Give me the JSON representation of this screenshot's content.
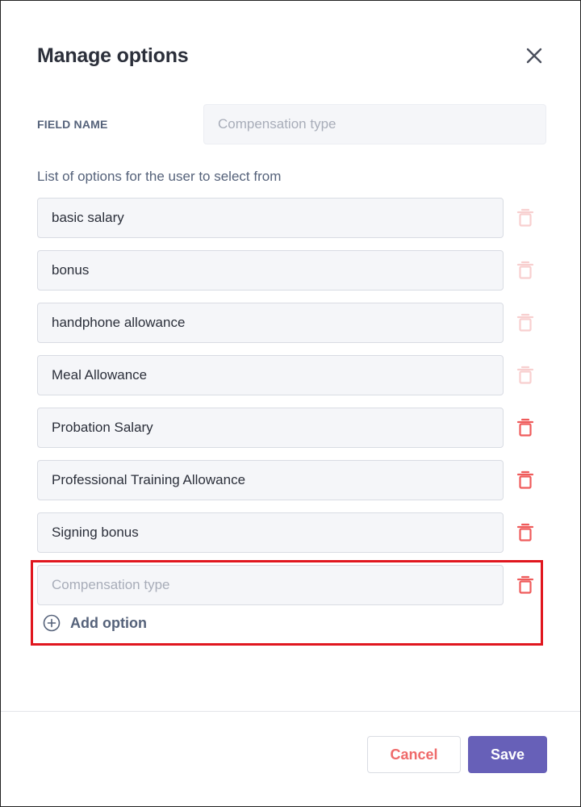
{
  "dialog": {
    "title": "Manage options",
    "close_icon": "close-icon"
  },
  "field": {
    "label": "FIELD NAME",
    "value": "",
    "placeholder": "Compensation type"
  },
  "options": {
    "label": "List of options for the user to select from",
    "items": [
      {
        "value": "basic salary",
        "delete_enabled": false
      },
      {
        "value": "bonus",
        "delete_enabled": false
      },
      {
        "value": "handphone allowance",
        "delete_enabled": false
      },
      {
        "value": "Meal Allowance",
        "delete_enabled": false
      },
      {
        "value": "Probation Salary",
        "delete_enabled": true
      },
      {
        "value": "Professional Training Allowance",
        "delete_enabled": true
      },
      {
        "value": "Signing bonus",
        "delete_enabled": true
      }
    ],
    "new_item": {
      "value": "",
      "placeholder": "Compensation type",
      "delete_enabled": true
    },
    "add_label": "Add option",
    "add_icon": "plus-circle-icon"
  },
  "footer": {
    "cancel_label": "Cancel",
    "save_label": "Save"
  },
  "colors": {
    "delete_enabled": "#ef5b5b",
    "delete_disabled": "#f8cfcf",
    "primary": "#6760b8",
    "highlight": "#e0161e"
  }
}
